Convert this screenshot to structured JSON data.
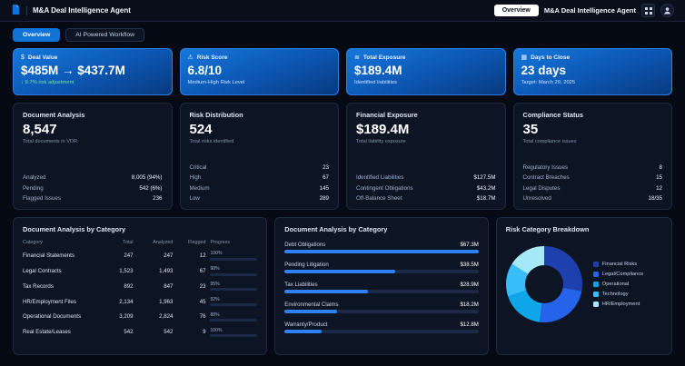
{
  "topbar": {
    "title": "M&A Deal Intelligence Agent",
    "overview_button": "Overview",
    "secondary_title": "M&A Deal Intelligence Agent",
    "logo_icon": "document-logo-icon",
    "right_icons": [
      "apps-grid-icon",
      "user-avatar-icon"
    ]
  },
  "tabs": [
    {
      "label": "Overview",
      "active": true
    },
    {
      "label": "AI Powered Workflow",
      "active": false
    }
  ],
  "colors": {
    "primary_blue": "#1173d4",
    "bar_fill": "#2f81f7",
    "positive_green": "#6ee7a0"
  },
  "kpis": [
    {
      "icon": "dollar-icon",
      "label": "Deal Value",
      "value": "$485M → $437.7M",
      "sub": "↓ 9.7% risk adjustment",
      "sub_color": "#6ee7a0"
    },
    {
      "icon": "alert-icon",
      "label": "Risk Score",
      "value": "6.8/10",
      "sub": "Medium-High Risk Level",
      "sub_color": "#cfe3ff"
    },
    {
      "icon": "liability-icon",
      "label": "Total Exposure",
      "value": "$189.4M",
      "sub": "Identified liabilities",
      "sub_color": "#cfe3ff"
    },
    {
      "icon": "calendar-icon",
      "label": "Days to Close",
      "value": "23 days",
      "sub": "Target: March 29, 2025",
      "sub_color": "#cfe3ff"
    }
  ],
  "stat_cards": [
    {
      "title": "Document Analysis",
      "value": "8,547",
      "subtitle": "Total documents in VDR",
      "rows": [
        {
          "label": "Analyzed",
          "value": "8,005 (94%)"
        },
        {
          "label": "Pending",
          "value": "542 (6%)"
        },
        {
          "label": "Flagged Issues",
          "value": "236"
        }
      ]
    },
    {
      "title": "Risk Distribution",
      "value": "524",
      "subtitle": "Total risks identified",
      "rows": [
        {
          "label": "Critical",
          "value": "23"
        },
        {
          "label": "High",
          "value": "67"
        },
        {
          "label": "Medium",
          "value": "145"
        },
        {
          "label": "Low",
          "value": "289"
        }
      ]
    },
    {
      "title": "Financial Exposure",
      "value": "$189.4M",
      "subtitle": "Total liability exposure",
      "rows": [
        {
          "label": "Identified Liabilities",
          "value": "$127.5M"
        },
        {
          "label": "Contingent Obligations",
          "value": "$43.2M"
        },
        {
          "label": "Off-Balance Sheet",
          "value": "$18.7M"
        }
      ]
    },
    {
      "title": "Compliance Status",
      "value": "35",
      "subtitle": "Total compliance issues",
      "rows": [
        {
          "label": "Regulatory Issues",
          "value": "8"
        },
        {
          "label": "Contract Breaches",
          "value": "15"
        },
        {
          "label": "Legal Disputes",
          "value": "12"
        },
        {
          "label": "Unresolved",
          "value": "18/35"
        }
      ]
    }
  ],
  "category_table": {
    "title": "Document Analysis by Category",
    "columns": [
      "Category",
      "Total",
      "Analyzed",
      "Flagged",
      "Progress"
    ],
    "rows": [
      {
        "category": "Financial Statements",
        "total": "247",
        "analyzed": "247",
        "flagged": "12",
        "progress": 100
      },
      {
        "category": "Legal Contracts",
        "total": "1,523",
        "analyzed": "1,493",
        "flagged": "67",
        "progress": 98
      },
      {
        "category": "Tax Records",
        "total": "892",
        "analyzed": "847",
        "flagged": "23",
        "progress": 95
      },
      {
        "category": "HR/Employment Files",
        "total": "2,134",
        "analyzed": "1,963",
        "flagged": "45",
        "progress": 92
      },
      {
        "category": "Operational Documents",
        "total": "3,209",
        "analyzed": "2,824",
        "flagged": "76",
        "progress": 88
      },
      {
        "category": "Real Estate/Leases",
        "total": "542",
        "analyzed": "542",
        "flagged": "9",
        "progress": 100
      }
    ]
  },
  "exposure_chart": {
    "title": "Document Analysis by Category",
    "type": "bar",
    "max_amount": 67.3,
    "bars": [
      {
        "label": "Debt Obligations",
        "value": "$67.3M",
        "amount": 67.3
      },
      {
        "label": "Pending Litigation",
        "value": "$38.5M",
        "amount": 38.5
      },
      {
        "label": "Tax Liabilities",
        "value": "$28.9M",
        "amount": 28.9
      },
      {
        "label": "Environmental Claims",
        "value": "$18.2M",
        "amount": 18.2
      },
      {
        "label": "Warranty/Product",
        "value": "$12.8M",
        "amount": 12.8
      }
    ]
  },
  "risk_donut": {
    "title": "Risk Category Breakdown",
    "type": "pie",
    "segments": [
      {
        "label": "Financial Risks",
        "percent": 28,
        "color": "#1e40af"
      },
      {
        "label": "Legal/Compliance",
        "percent": 24,
        "color": "#2563eb"
      },
      {
        "label": "Operational",
        "percent": 18,
        "color": "#0ea5e9"
      },
      {
        "label": "Technology",
        "percent": 14,
        "color": "#38bdf8"
      },
      {
        "label": "HR/Employment",
        "percent": 16,
        "color": "#a5e8fa"
      }
    ]
  }
}
